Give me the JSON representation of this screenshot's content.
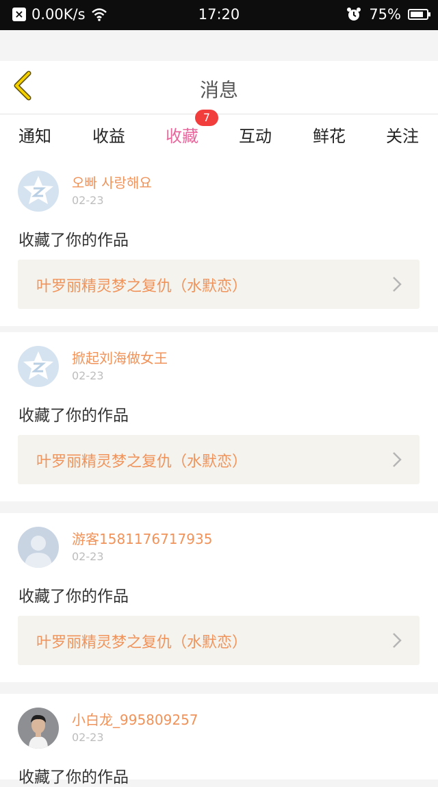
{
  "status": {
    "speed": "0.00K/s",
    "time": "17:20",
    "battery": "75%"
  },
  "header": {
    "title": "消息"
  },
  "tabs": [
    {
      "label": "通知"
    },
    {
      "label": "收益"
    },
    {
      "label": "收藏",
      "badge": "7",
      "active": true
    },
    {
      "label": "互动"
    },
    {
      "label": "鲜花"
    },
    {
      "label": "关注"
    }
  ],
  "messages": [
    {
      "username": "오빠 사랑해요",
      "date": "02-23",
      "action": "收藏了你的作品",
      "work_title": "叶罗丽精灵梦之复仇（水默恋）",
      "avatar": "qq-default-icon"
    },
    {
      "username": "掀起刘海做女王",
      "date": "02-23",
      "action": "收藏了你的作品",
      "work_title": "叶罗丽精灵梦之复仇（水默恋）",
      "avatar": "qq-default-icon"
    },
    {
      "username": "游客1581176717935",
      "date": "02-23",
      "action": "收藏了你的作品",
      "work_title": "叶罗丽精灵梦之复仇（水默恋）",
      "avatar": "guest-user-icon"
    },
    {
      "username": "小白龙_995809257",
      "date": "02-23",
      "action": "收藏了你的作品",
      "work_title": "",
      "avatar": "photo-avatar"
    }
  ],
  "colors": {
    "accent_pink": "#e8669b",
    "orange_text": "#f0935a",
    "badge_red": "#f23d3d"
  }
}
